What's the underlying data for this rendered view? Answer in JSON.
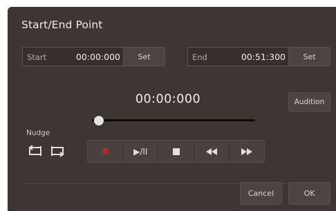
{
  "dialog": {
    "title": "Start/End Point"
  },
  "start": {
    "label": "Start",
    "value": "00:00:000",
    "set_label": "Set"
  },
  "end": {
    "label": "End",
    "value": "00:51:300",
    "set_label": "Set"
  },
  "current_time": "00:00:000",
  "position_fraction": 0.0,
  "audition_label": "Audition",
  "nudge": {
    "label": "Nudge",
    "icons": [
      "nudge-back-icon",
      "nudge-forward-icon"
    ]
  },
  "transport": {
    "record_icon": "record-icon",
    "play_pause_label": "▶/II",
    "stop_icon": "stop-icon",
    "rewind_icon": "rewind-icon",
    "fast_forward_icon": "fast-forward-icon"
  },
  "footer": {
    "cancel_label": "Cancel",
    "ok_label": "OK"
  },
  "colors": {
    "dialog_bg": "#3e3633",
    "record_red": "#b52a2f",
    "text": "#f3eeea"
  }
}
